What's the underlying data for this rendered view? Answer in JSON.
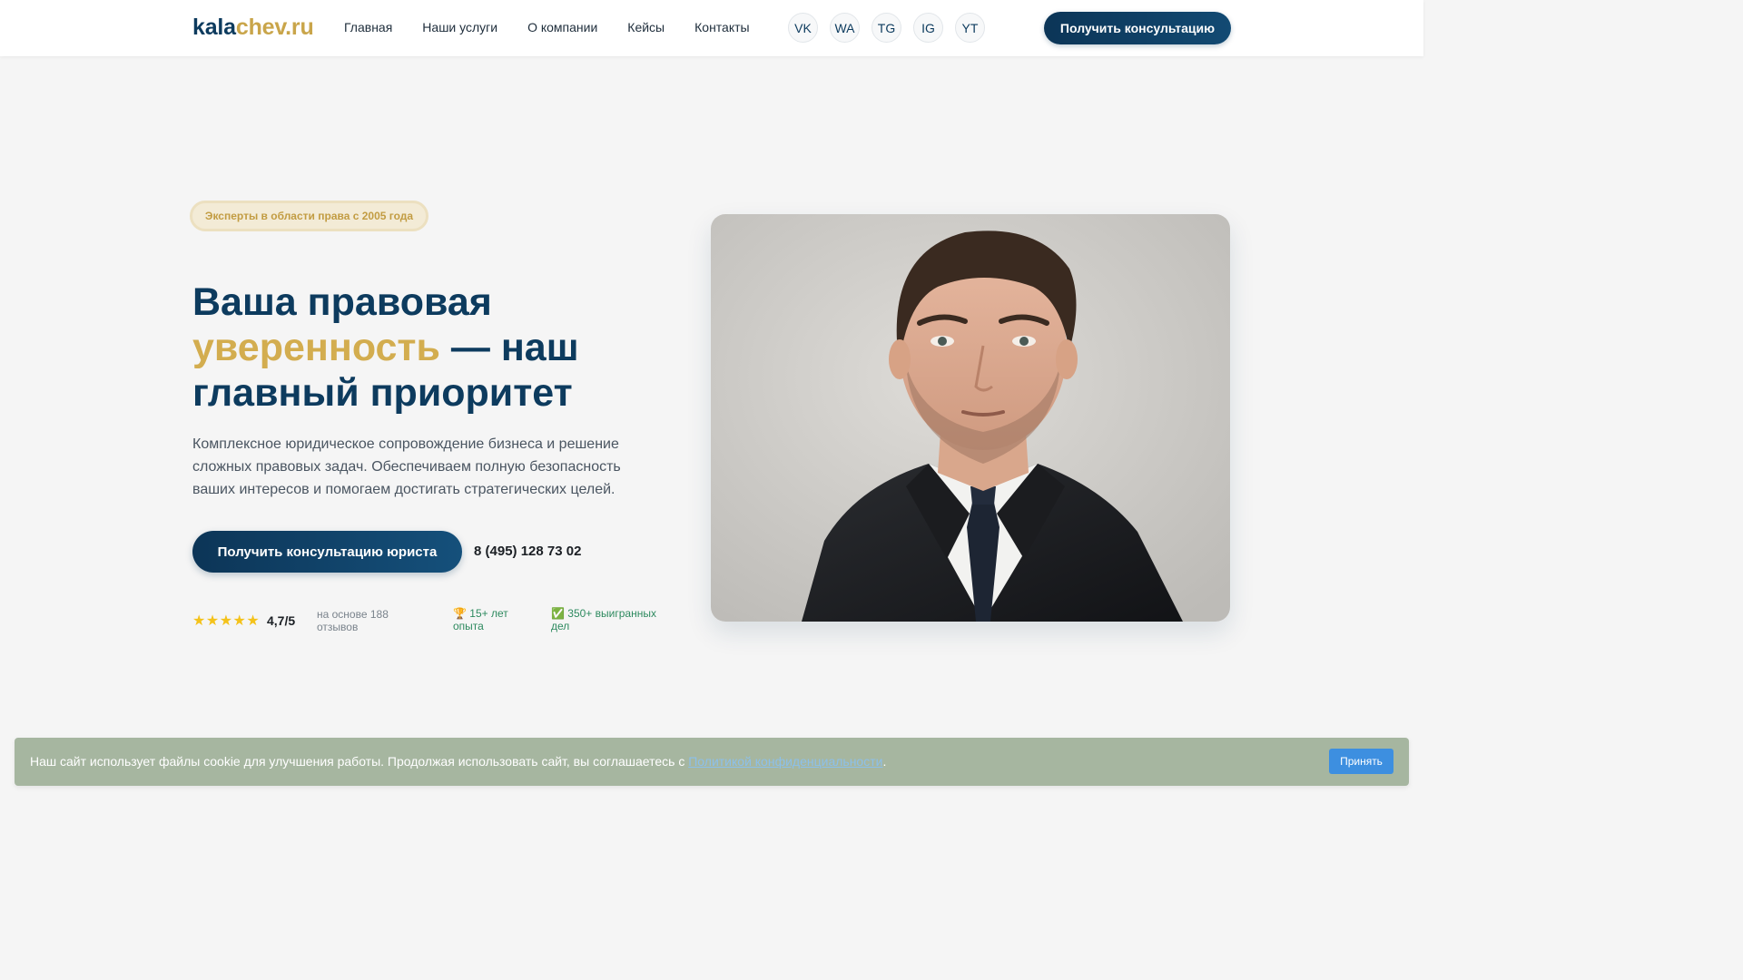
{
  "header": {
    "logo_part1": "kala",
    "logo_part2": "chev.ru",
    "nav": [
      "Главная",
      "Наши услуги",
      "О компании",
      "Кейсы",
      "Контакты"
    ],
    "socials": [
      "VK",
      "WA",
      "TG",
      "IG",
      "YT"
    ],
    "cta_label": "Получить консультацию"
  },
  "hero": {
    "badge": "Эксперты в области права с 2005 года",
    "headline_part1": "Ваша правовая",
    "headline_gold": "уверенность",
    "headline_part2": "— наш главный приоритет",
    "lead": "Комплексное юридическое сопровождение бизнеса и решение сложных правовых задач. Обеспечиваем полную безопасность ваших интересов и помогаем достигать стратегических целей.",
    "cta_label": "Получить консультацию юриста",
    "phone": "8 (495) 128 73 02",
    "stars": "★★★★★",
    "rating": "4,7/5",
    "reviews": "на основе 188 отзывов",
    "stat_experience": "🏆 15+ лет опыта",
    "stat_cases": "✅ 350+ выигранных дел"
  },
  "cookie": {
    "text": "Наш сайт использует файлы cookie для улучшения работы. Продолжая использовать сайт, вы соглашаетесь с",
    "link": "Политикой конфиденциальности",
    "period": ".",
    "accept": "Принять"
  },
  "colors": {
    "navy": "#0d3b5e",
    "gold": "#c9a54a",
    "background": "#f5f5f5",
    "cookie_bar": "#a6b6a0",
    "accept_button": "#3d8fe0"
  }
}
